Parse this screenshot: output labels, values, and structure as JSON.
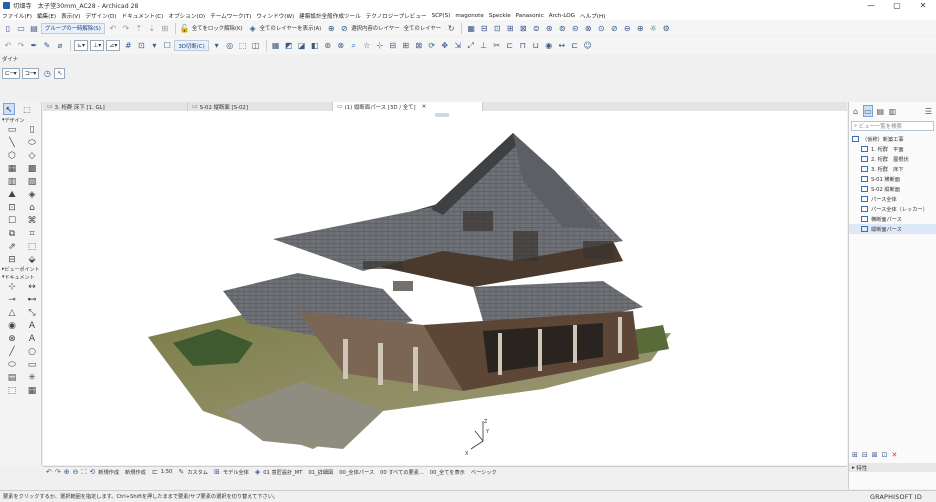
{
  "window": {
    "title": "切畑寺　太子堂30mm_AC28 - Archicad 28",
    "buttons": [
      "—",
      "▢",
      "✕"
    ]
  },
  "menu": [
    "ファイル(F)",
    "編集(E)",
    "表示(V)",
    "デザイン(D)",
    "ドキュメント(C)",
    "オプション(O)",
    "チームワーク(T)",
    "ウィンドウ(W)",
    "建築設計全般作成ツール",
    "テクノロジープレビュー",
    "SCP(S)",
    "magonote",
    "Speckle",
    "Panasonic",
    "Arch-LOG",
    "ヘルプ(H)"
  ],
  "toolbar1": {
    "group_button": "グループの一時解除(S)",
    "lock_all": "全てをロック解除(K)",
    "show_all_layers": "全てのレイヤーを表示(A)",
    "selection_layer": "選択内容のレイヤー",
    "all_layers": "全てのレイヤー"
  },
  "toolbar2": {
    "view_button": "3D切断(C)"
  },
  "toolbar3": {
    "label": "ダイナ"
  },
  "toolbox": {
    "sections": [
      "デザイン",
      "ビューポイント",
      "ドキュメント"
    ],
    "design_icons": [
      "▭",
      "▯",
      "╲",
      "⬭",
      "⬡",
      "◇",
      "▦",
      "▩",
      "▥",
      "▧",
      "⛰",
      "◈",
      "⊡",
      "⌂",
      "☐",
      "⌘",
      "⧉",
      "⌗",
      "⇗",
      "⬚",
      "⊟",
      "⬙"
    ],
    "doc_icons": [
      "⊹",
      "↔",
      "⊸",
      "⊷",
      "△",
      "⤡",
      "◉",
      "A",
      "⊗",
      "A",
      "╱",
      "○",
      "⬭",
      "▭",
      "▤",
      "✳",
      "⬚",
      "▦"
    ]
  },
  "tabs": [
    {
      "label": "3. 桁群 床下 [1. GL]",
      "active": false
    },
    {
      "label": "S-02 縦断面 [S-02]",
      "active": false
    },
    {
      "label": "(1) 縦断面パース [3D / 全て]",
      "active": true
    }
  ],
  "navigator": {
    "search_placeholder": "ビュー一覧を検索",
    "tree": [
      {
        "label": "（仮称）新築工事",
        "level": 0,
        "selected": false
      },
      {
        "label": "1. 桁群　平面",
        "level": 1,
        "selected": false
      },
      {
        "label": "2. 桁群　屋根伏",
        "level": 1,
        "selected": false
      },
      {
        "label": "3. 桁群　床下",
        "level": 1,
        "selected": false
      },
      {
        "label": "S-01 横断面",
        "level": 1,
        "selected": false
      },
      {
        "label": "S-02 縦断面",
        "level": 1,
        "selected": false
      },
      {
        "label": "パース全体",
        "level": 1,
        "selected": false
      },
      {
        "label": "パース全体（レッカー）",
        "level": 1,
        "selected": false
      },
      {
        "label": "横断面パース",
        "level": 1,
        "selected": false
      },
      {
        "label": "縦断面パース",
        "level": 1,
        "selected": true
      }
    ],
    "properties_label": "特性"
  },
  "bottombar": {
    "undo_label": "新規作成",
    "redo_label": "新規作成",
    "scale": "1:50",
    "pen_set": "カスタム",
    "model_view": "モデル全体",
    "layer_combo": "01 意匠設計_MT",
    "dim": "01_詳細図",
    "renovation": "00_全体パース",
    "graphic_override": "00 すべての要素...",
    "structure": "00_全てを表示",
    "paper": "ベーシック"
  },
  "statusbar": {
    "hint": "要素をクリックするか、選択範囲を指定します。Ctrl+Shiftを押したままで要素/サブ要素の選択を切り替えて下さい。",
    "brand": "GRAPHISOFT ID"
  },
  "axis": {
    "x": "X",
    "y": "Y",
    "z": "Z"
  },
  "colors": {
    "accent": "#2a6bc0",
    "roof": "#6e7176",
    "wood": "#6b4a2e",
    "ground": "#8a8a5a"
  }
}
